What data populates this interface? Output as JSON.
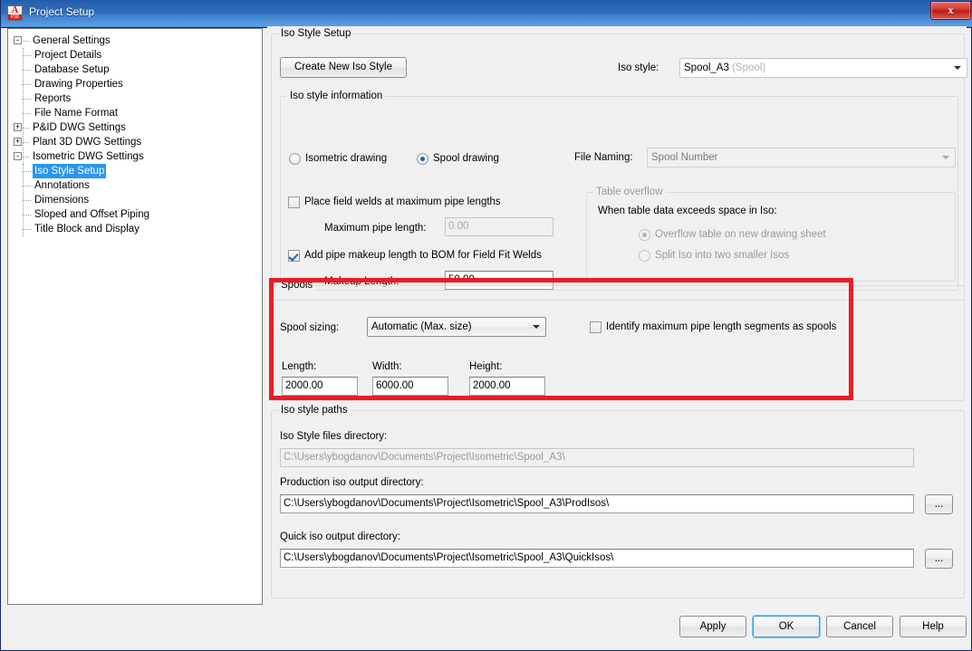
{
  "window": {
    "title": "Project Setup",
    "app_icon": "plant3d-icon",
    "icon_letter": "A",
    "icon_sub": "P3D",
    "close_label": "x"
  },
  "tree": {
    "items": [
      {
        "label": "General Settings",
        "depth": 0,
        "expander": "-",
        "selected": false
      },
      {
        "label": "Project Details",
        "depth": 1,
        "expander": "",
        "selected": false
      },
      {
        "label": "Database Setup",
        "depth": 1,
        "expander": "",
        "selected": false
      },
      {
        "label": "Drawing Properties",
        "depth": 1,
        "expander": "",
        "selected": false
      },
      {
        "label": "Reports",
        "depth": 1,
        "expander": "",
        "selected": false
      },
      {
        "label": "File Name Format",
        "depth": 1,
        "expander": "",
        "selected": false
      },
      {
        "label": "P&ID DWG Settings",
        "depth": 0,
        "expander": "+",
        "selected": false
      },
      {
        "label": "Plant 3D DWG Settings",
        "depth": 0,
        "expander": "+",
        "selected": false
      },
      {
        "label": "Isometric DWG Settings",
        "depth": 0,
        "expander": "-",
        "selected": false
      },
      {
        "label": "Iso Style Setup",
        "depth": 1,
        "expander": "",
        "selected": true
      },
      {
        "label": "Annotations",
        "depth": 1,
        "expander": "",
        "selected": false
      },
      {
        "label": "Dimensions",
        "depth": 1,
        "expander": "",
        "selected": false
      },
      {
        "label": "Sloped and Offset Piping",
        "depth": 1,
        "expander": "",
        "selected": false
      },
      {
        "label": "Title Block and Display",
        "depth": 1,
        "expander": "",
        "selected": false
      }
    ]
  },
  "iso_style_setup": {
    "group_title": "Iso Style Setup",
    "create_button": "Create New Iso Style",
    "iso_style_label": "Iso style:",
    "iso_style_value": "Spool_A3",
    "iso_style_suffix": "(Spool)"
  },
  "iso_style_information": {
    "group_title": "Iso style information",
    "radio_isometric": "Isometric drawing",
    "radio_spool": "Spool drawing",
    "selected_drawing_type": "Spool drawing",
    "file_naming_label": "File Naming:",
    "file_naming_value": "Spool Number",
    "cb_field_welds": "Place field welds at maximum pipe lengths",
    "cb_field_welds_checked": false,
    "max_pipe_length_label": "Maximum pipe length:",
    "max_pipe_length_value": "0.00",
    "cb_makeup": "Add pipe makeup length to BOM for Field Fit Welds",
    "cb_makeup_checked": true,
    "makeup_length_label": "Makeup Length:",
    "makeup_length_value": "50.00",
    "table_overflow": {
      "group_title": "Table overflow",
      "prompt": "When table data exceeds space in Iso:",
      "option_overflow": "Overflow table on new drawing sheet",
      "option_split": "Split Iso into two smaller Isos",
      "selected": "Overflow table on new drawing sheet",
      "enabled": false
    }
  },
  "spools": {
    "group_title": "Spools",
    "spool_sizing_label": "Spool sizing:",
    "spool_sizing_value": "Automatic (Max. size)",
    "cb_identify": "Identify maximum pipe length segments as spools",
    "cb_identify_checked": false,
    "length_label": "Length:",
    "length_value": "2000.00",
    "width_label": "Width:",
    "width_value": "6000.00",
    "height_label": "Height:",
    "height_value": "2000.00",
    "highlight_color": "#ed1c24"
  },
  "iso_style_paths": {
    "group_title": "Iso style paths",
    "files_dir_label": "Iso Style files directory:",
    "files_dir_value": "C:\\Users\\ybogdanov\\Documents\\Project\\Isometric\\Spool_A3\\",
    "prod_dir_label": "Production iso output directory:",
    "prod_dir_value": "C:\\Users\\ybogdanov\\Documents\\Project\\Isometric\\Spool_A3\\ProdIsos\\",
    "quick_dir_label": "Quick iso output directory:",
    "quick_dir_value": "C:\\Users\\ybogdanov\\Documents\\Project\\Isometric\\Spool_A3\\QuickIsos\\",
    "browse_label": "..."
  },
  "footer": {
    "apply": "Apply",
    "ok": "OK",
    "cancel": "Cancel",
    "help": "Help",
    "focused": "OK"
  }
}
